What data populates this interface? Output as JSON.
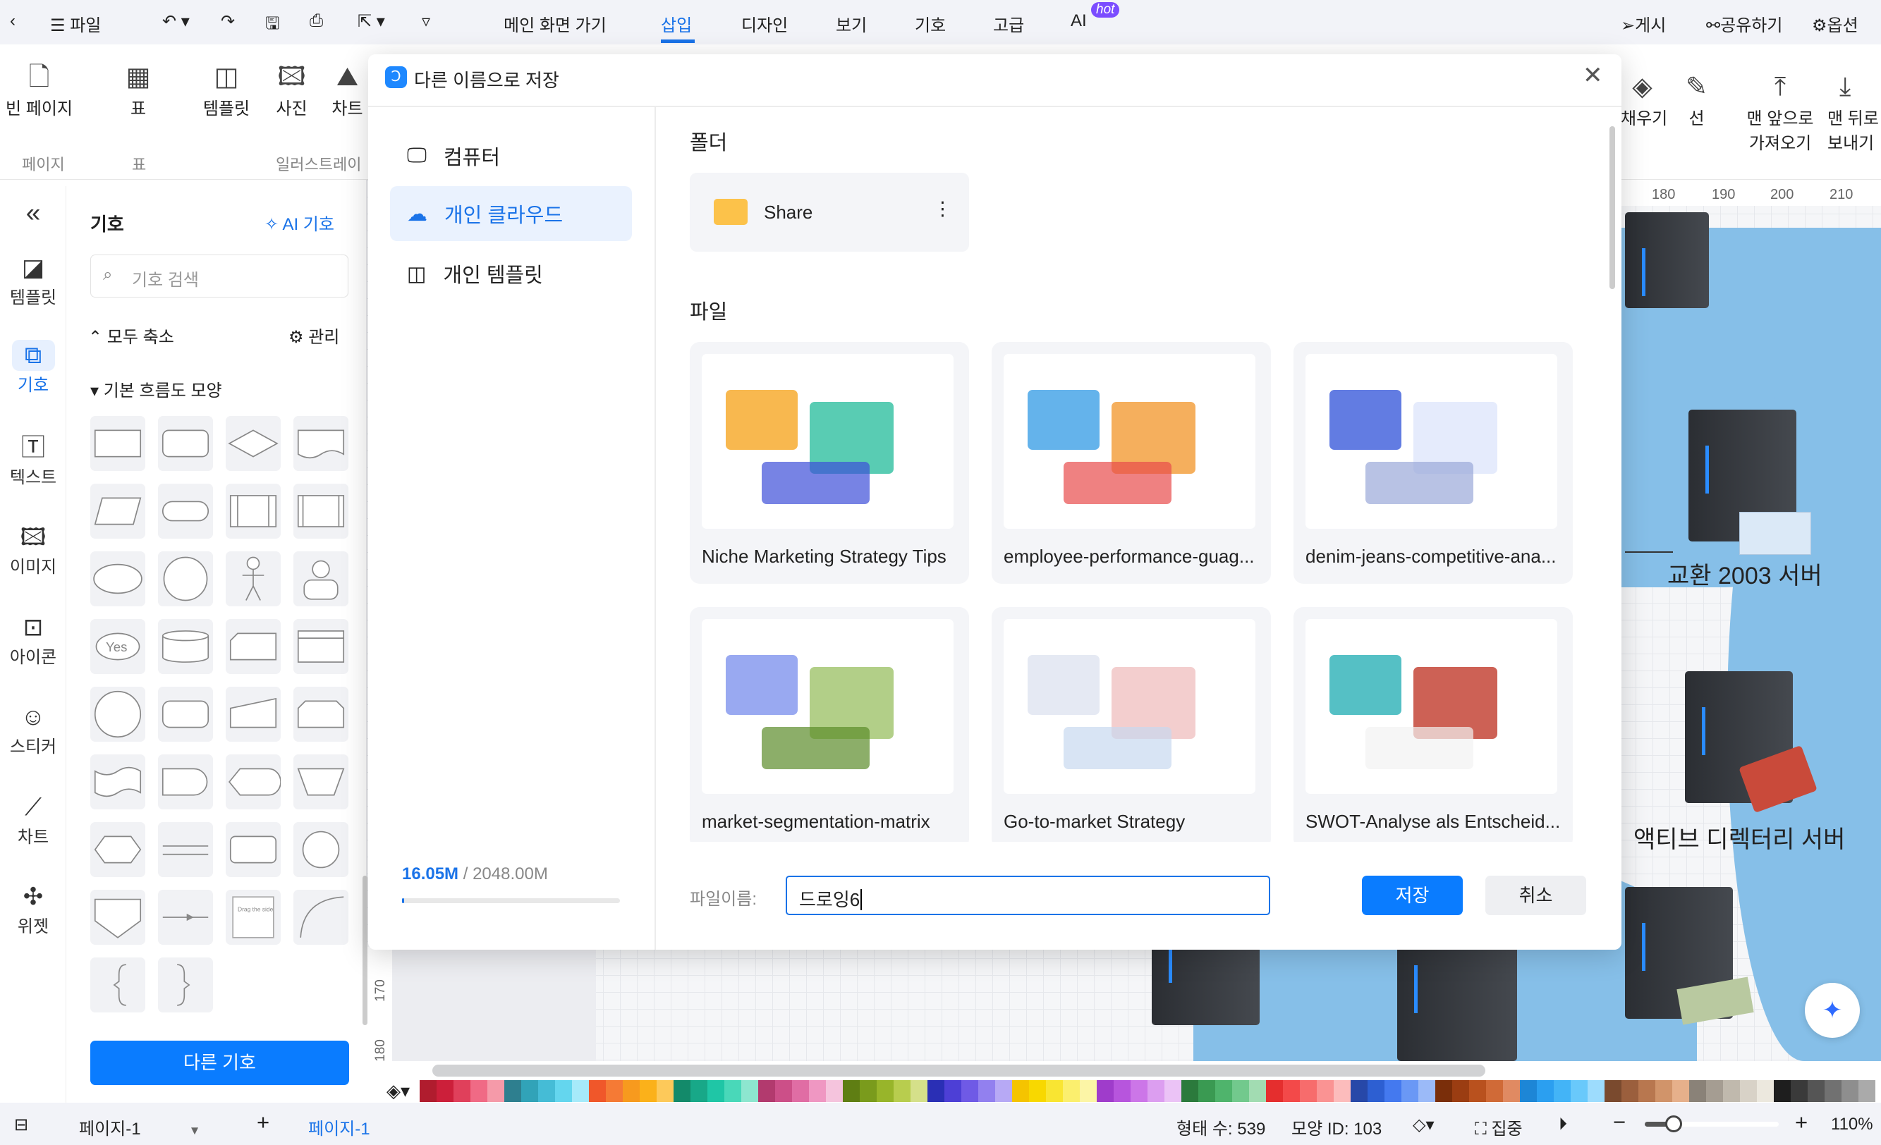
{
  "topbar": {
    "file": "파일",
    "menus": [
      "메인 화면 가기",
      "삽입",
      "디자인",
      "보기",
      "기호",
      "고급",
      "AI"
    ],
    "active": "삽입",
    "hot": "hot",
    "right": [
      "게시",
      "공유하기",
      "옵션"
    ]
  },
  "ribbon": {
    "items": [
      "빈 페이지",
      "표",
      "템플릿",
      "사진",
      "차트"
    ],
    "groups": [
      "페이지",
      "표",
      "일러스트레이"
    ],
    "right_items": [
      "채우기",
      "선",
      "맨 앞으로\n가져오기",
      "맨 뒤로\n보내기"
    ],
    "right_a": "채우기",
    "right_b": "선",
    "right_c1": "맨 앞으로",
    "right_c2": "가져오기",
    "right_d1": "맨 뒤로",
    "right_d2": "보내기"
  },
  "rail": {
    "items": [
      "템플릿",
      "기호",
      "텍스트",
      "이미지",
      "아이콘",
      "스티커",
      "차트",
      "위젯"
    ],
    "active": "기호"
  },
  "panel": {
    "title": "기호",
    "ai": "AI 기호",
    "search_placeholder": "기호 검색",
    "collapse": "모두 축소",
    "manage": "관리",
    "section": "기본 흐름도 모양",
    "more": "다른 기호",
    "shapes": [
      "rectangle",
      "rounded-rect",
      "diamond",
      "document",
      "parallelogram",
      "terminator",
      "process",
      "predefined",
      "ellipse",
      "circle",
      "person",
      "user",
      "yes-bubble",
      "cylinder",
      "card",
      "internal-storage",
      "circle-large",
      "drum",
      "manual-input",
      "loop-limit",
      "tape",
      "delay",
      "display",
      "trapezoid",
      "hexagon",
      "lines",
      "rounded-square",
      "circle-small",
      "off-page",
      "arrow-line",
      "note",
      "arc",
      "brace-left",
      "brace-right"
    ]
  },
  "canvas": {
    "ruler": [
      "180",
      "190",
      "200",
      "210"
    ],
    "ruler_v": [
      "170",
      "180"
    ],
    "label1": "교환 2003 서버",
    "label2": "액티브 디렉터리 서버"
  },
  "dialog": {
    "title": "다른 이름으로 저장",
    "nav": [
      "컴퓨터",
      "개인 클라우드",
      "개인 템플릿"
    ],
    "active": "개인 클라우드",
    "storage_used": "16.05M",
    "storage_total": "/ 2048.00M",
    "storage_fraction": 0.0078,
    "folder_heading": "폴더",
    "folder": "Share",
    "files_heading": "파일",
    "files": [
      "Niche Marketing Strategy Tips",
      "employee-performance-guag...",
      "denim-jeans-competitive-ana...",
      "market-segmentation-matrix",
      "Go-to-market Strategy",
      "SWOT-Analyse als Entscheid..."
    ],
    "filename_label": "파일이름:",
    "filename_value": "드로잉6",
    "save": "저장",
    "cancel": "취소"
  },
  "status": {
    "page_dropdown": "페이지-1",
    "page_tab": "페이지-1",
    "shape_count": "형태 수: 539",
    "shape_id": "모양 ID: 103",
    "focus": "집중",
    "zoom": "110%",
    "zoom_level": 1.1
  },
  "palette": [
    "#b01c2e",
    "#cc1f3a",
    "#e0405b",
    "#f06a85",
    "#f59aa9",
    "#2e7f8f",
    "#31a3b8",
    "#45bcd6",
    "#64d6ee",
    "#a6eafa",
    "#f0572a",
    "#f57a35",
    "#f79a1e",
    "#fbb11a",
    "#fdc95a",
    "#138a6a",
    "#18a888",
    "#1fc6a6",
    "#49d8b9",
    "#8de6cf",
    "#b23a6e",
    "#cc4f88",
    "#e06da4",
    "#ef97c2",
    "#f5c4dd",
    "#5f7e13",
    "#7a9b1c",
    "#98b52a",
    "#b8cd4e",
    "#d5e08a",
    "#2a2fb5",
    "#4d3fd6",
    "#6f5ae6",
    "#9280ef",
    "#b7a9f5",
    "#f5c400",
    "#f8d800",
    "#f9e532",
    "#fbef6e",
    "#fcf5a6",
    "#9f3ccb",
    "#b755dd",
    "#cc76e8",
    "#dc9ef0",
    "#ebc3f6",
    "#2b7a3c",
    "#3a9a52",
    "#4fb46c",
    "#72c98d",
    "#a2dcb2",
    "#e52e2e",
    "#f34949",
    "#f76c6c",
    "#fa9393",
    "#fcbcbc",
    "#2748a8",
    "#2d5fd2",
    "#4479ef",
    "#6a98f5",
    "#9bbaf8",
    "#7a2e0a",
    "#9b3d12",
    "#b9511e",
    "#d06a37",
    "#e08a62",
    "#1d86d6",
    "#2b9ff0",
    "#43b4f7",
    "#69c9fb",
    "#9ddcfd",
    "#7a4a2e",
    "#9b5f3d",
    "#b8774f",
    "#d1946a",
    "#e6b08b",
    "#8a8278",
    "#a59d92",
    "#c0b9ad",
    "#d8d2c7",
    "#ece8de",
    "#1e1e1e",
    "#3a3a3a",
    "#555555",
    "#717171",
    "#8e8e8e",
    "#aaaaaa"
  ]
}
